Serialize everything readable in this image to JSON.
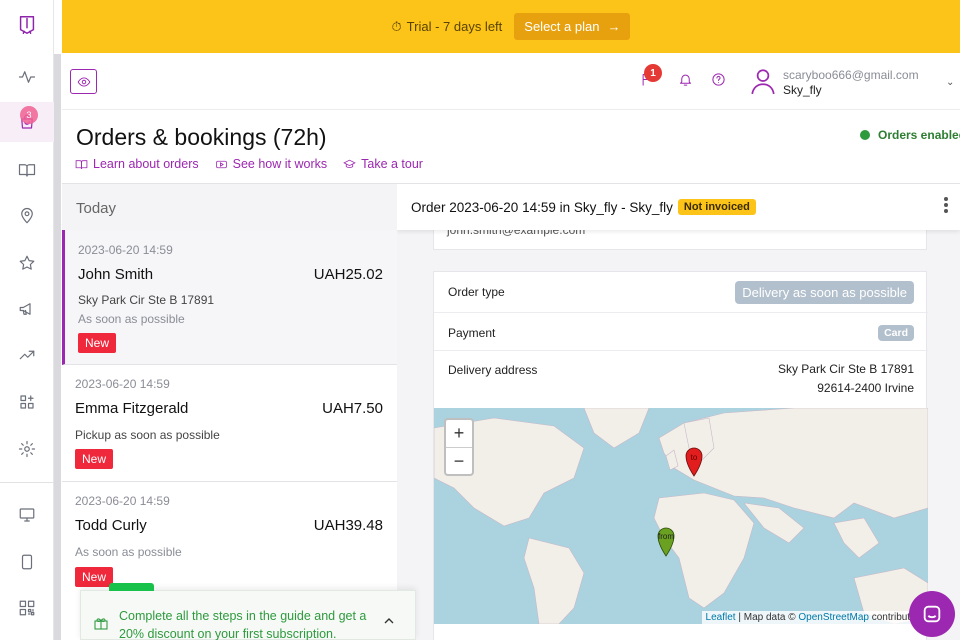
{
  "trial": {
    "text": "Trial - 7 days left",
    "button": "Select a plan"
  },
  "rail": {
    "orders_badge": "3"
  },
  "header": {
    "flag_badge": "1",
    "email": "scaryboo666@gmail.com",
    "name": "Sky_fly"
  },
  "page": {
    "title": "Orders & bookings (72h)",
    "links": [
      "Learn about orders",
      "See how it works",
      "Take a tour"
    ],
    "status": "Orders enabled"
  },
  "list": {
    "group": "Today",
    "orders": [
      {
        "time": "2023-06-20 14:59",
        "name": "John Smith",
        "amount": "UAH25.02",
        "line1": "Sky Park Cir Ste B 17891",
        "line2": "As soon as possible",
        "badge": "New"
      },
      {
        "time": "2023-06-20 14:59",
        "name": "Emma Fitzgerald",
        "amount": "UAH7.50",
        "line1": "Pickup as soon as possible",
        "badge": "New"
      },
      {
        "time": "2023-06-20 14:59",
        "name": "Todd Curly",
        "amount": "UAH39.48",
        "line2": "As soon as possible",
        "badge": "New"
      }
    ]
  },
  "detail": {
    "title": "Order 2023-06-20 14:59 in Sky_fly - Sky_fly",
    "status_badge": "Not invoiced",
    "email": "john.smith@example.com",
    "order_type_label": "Order type",
    "order_type_value": "Delivery as soon as possible",
    "payment_label": "Payment",
    "payment_value": "Card",
    "address_label": "Delivery address",
    "address_line1": "Sky Park Cir Ste B 17891",
    "address_line2": "92614-2400 Irvine",
    "map": {
      "zoom_in": "+",
      "zoom_out": "−",
      "marker_to": "to",
      "marker_from": "from",
      "attr_leaflet": "Leaflet",
      "attr_mid": " | Map data © ",
      "attr_osm": "OpenStreetMap",
      "attr_end": " contributors"
    }
  },
  "guide": {
    "text": "Complete all the steps in the guide and get a 20% discount on your first subscription."
  },
  "colors": {
    "accent": "#9c27b0",
    "trial_bar": "#fcc419",
    "new_badge": "#f0283c",
    "enabled": "#2e9a3e"
  }
}
